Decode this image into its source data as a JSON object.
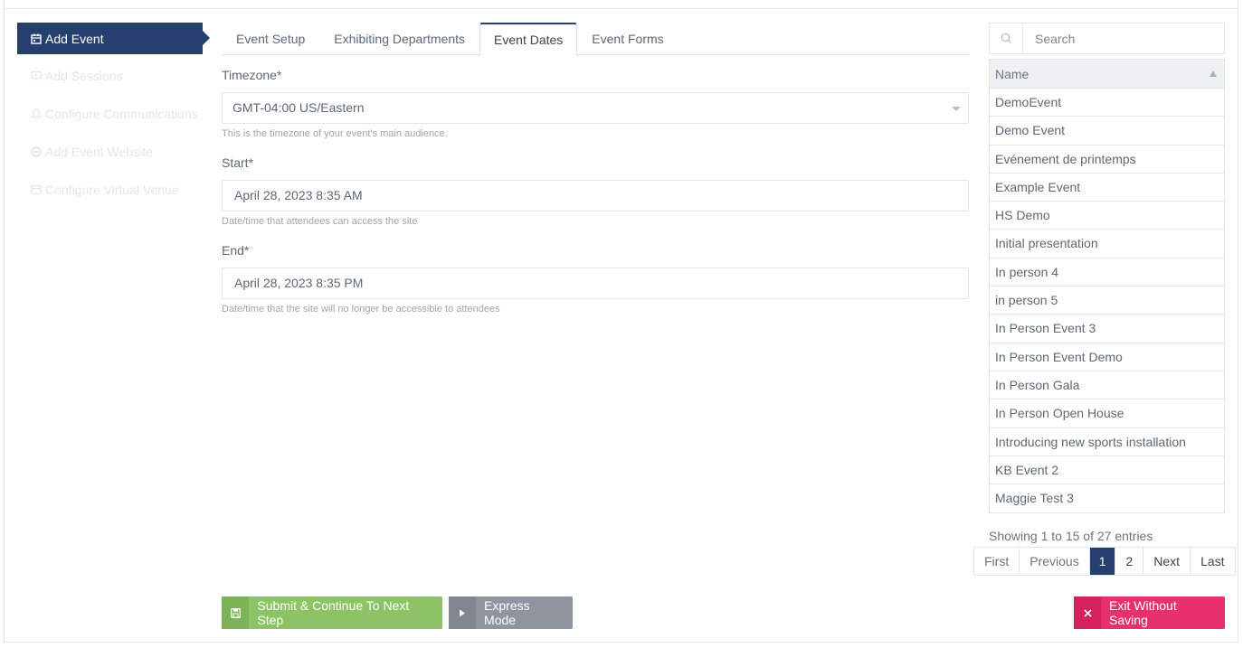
{
  "sidebar": {
    "items": [
      {
        "label": "Add Event",
        "icon": "calendar-icon",
        "active": true
      },
      {
        "label": "Add Sessions",
        "icon": "presentation-icon",
        "active": false
      },
      {
        "label": "Configure Communications",
        "icon": "bell-icon",
        "active": false
      },
      {
        "label": "Add Event Website",
        "icon": "globe-icon",
        "active": false
      },
      {
        "label": "Configure Virtual Venue",
        "icon": "window-icon",
        "active": false
      }
    ]
  },
  "tabs": [
    {
      "label": "Event Setup",
      "active": false
    },
    {
      "label": "Exhibiting Departments",
      "active": false
    },
    {
      "label": "Event Dates",
      "active": true
    },
    {
      "label": "Event Forms",
      "active": false
    }
  ],
  "form": {
    "timezone": {
      "label": "Timezone*",
      "value": "GMT-04:00 US/Eastern",
      "help": "This is the timezone of your event's main audience."
    },
    "start": {
      "label": "Start*",
      "value": "April 28, 2023 8:35 AM",
      "help": "Date/time that attendees can access the site"
    },
    "end": {
      "label": "End*",
      "value": "April 28, 2023 8:35 PM",
      "help": "Date/time that the site will no longer be accessible to attendees"
    }
  },
  "search": {
    "placeholder": "Search"
  },
  "table": {
    "header": "Name",
    "rows": [
      "DemoEvent",
      "Demo Event",
      "Evénement de printemps",
      "Example Event",
      "HS Demo",
      "Initial presentation",
      "In person 4",
      "in person 5",
      "In Person Event 3",
      "In Person Event Demo",
      "In Person Gala",
      "In Person Open House",
      "Introducing new sports installation",
      "KB Event 2",
      "Maggie Test 3"
    ],
    "info": "Showing 1 to 15 of 27 entries"
  },
  "pagination": {
    "first": "First",
    "previous": "Previous",
    "page1": "1",
    "page2": "2",
    "next": "Next",
    "last": "Last"
  },
  "buttons": {
    "submit": "Submit & Continue To Next Step",
    "express": "Express Mode",
    "exit": "Exit Without Saving"
  },
  "colors": {
    "primary": "#253f6e",
    "success": "#8cc465",
    "secondary": "#8f949f",
    "danger": "#e8306a"
  }
}
